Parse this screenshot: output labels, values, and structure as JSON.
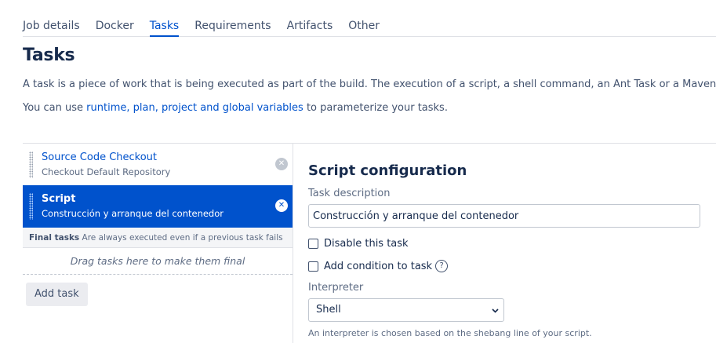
{
  "tabs": [
    {
      "label": "Job details",
      "active": false
    },
    {
      "label": "Docker",
      "active": false
    },
    {
      "label": "Tasks",
      "active": true
    },
    {
      "label": "Requirements",
      "active": false
    },
    {
      "label": "Artifacts",
      "active": false
    },
    {
      "label": "Other",
      "active": false
    }
  ],
  "page": {
    "title": "Tasks",
    "description": "A task is a piece of work that is being executed as part of the build. The execution of a script, a shell command, an Ant Task or a Maven goal a",
    "variables_prefix": "You can use ",
    "variables_link": "runtime, plan, project and global variables",
    "variables_suffix": " to parameterize your tasks."
  },
  "tasks": [
    {
      "name": "Source Code Checkout",
      "description": "Checkout Default Repository",
      "selected": false
    },
    {
      "name": "Script",
      "description": "Construcción y arranque del contenedor",
      "selected": true
    }
  ],
  "final_tasks": {
    "label": "Final tasks",
    "hint": "Are always executed even if a previous task fails",
    "drop_text": "Drag tasks here to make them final"
  },
  "add_task_label": "Add task",
  "config": {
    "title": "Script configuration",
    "description_label": "Task description",
    "description_value": "Construcción y arranque del contenedor",
    "disable_label": "Disable this task",
    "disable_checked": false,
    "condition_label": "Add condition to task",
    "condition_checked": false,
    "interpreter_label": "Interpreter",
    "interpreter_value": "Shell",
    "interpreter_hint": "An interpreter is chosen based on the shebang line of your script."
  },
  "icons": {
    "remove": "close-circle-icon",
    "grip": "drag-handle-icon",
    "help": "question-circle-icon",
    "chevron": "chevron-down-icon"
  },
  "colors": {
    "accent": "#0052cc",
    "text": "#172b4d",
    "muted": "#5e6c84"
  }
}
